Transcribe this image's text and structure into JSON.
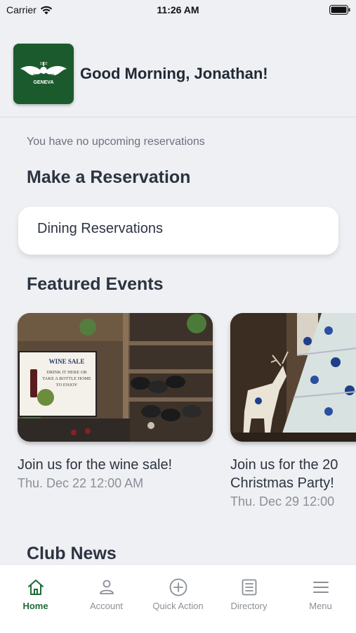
{
  "status_bar": {
    "carrier": "Carrier",
    "time": "11:26 AM"
  },
  "header": {
    "logo": {
      "year": "1902",
      "name": "GENEVA",
      "color": "#1b5a2d"
    },
    "greeting": "Good Morning, Jonathan!"
  },
  "reservations": {
    "empty_text": "You have no upcoming reservations",
    "section_title": "Make a Reservation",
    "items": [
      {
        "label": "Dining Reservations"
      }
    ]
  },
  "featured_events": {
    "section_title": "Featured Events",
    "events": [
      {
        "title": "Join us for the wine sale!",
        "title_line2": "",
        "date": "Thu. Dec 22 12:00 AM",
        "image": "wine-sale-photo",
        "sign_text": [
          "WINE SALE",
          "DRINK IT HERE OR",
          "TAKE A BOTTLE HOME",
          "TO ENJOY"
        ]
      },
      {
        "title": "Join us for the 20",
        "title_line2": "Christmas Party!",
        "date": "Thu. Dec 29 12:00",
        "image": "christmas-tree-photo"
      }
    ]
  },
  "club_news": {
    "section_title": "Club News"
  },
  "tab_bar": {
    "active_color": "#1e6b35",
    "tabs": [
      {
        "label": "Home",
        "icon": "home-icon",
        "active": true
      },
      {
        "label": "Account",
        "icon": "person-icon",
        "active": false
      },
      {
        "label": "Quick Action",
        "icon": "plus-circle-icon",
        "active": false
      },
      {
        "label": "Directory",
        "icon": "directory-icon",
        "active": false
      },
      {
        "label": "Menu",
        "icon": "hamburger-icon",
        "active": false
      }
    ]
  }
}
